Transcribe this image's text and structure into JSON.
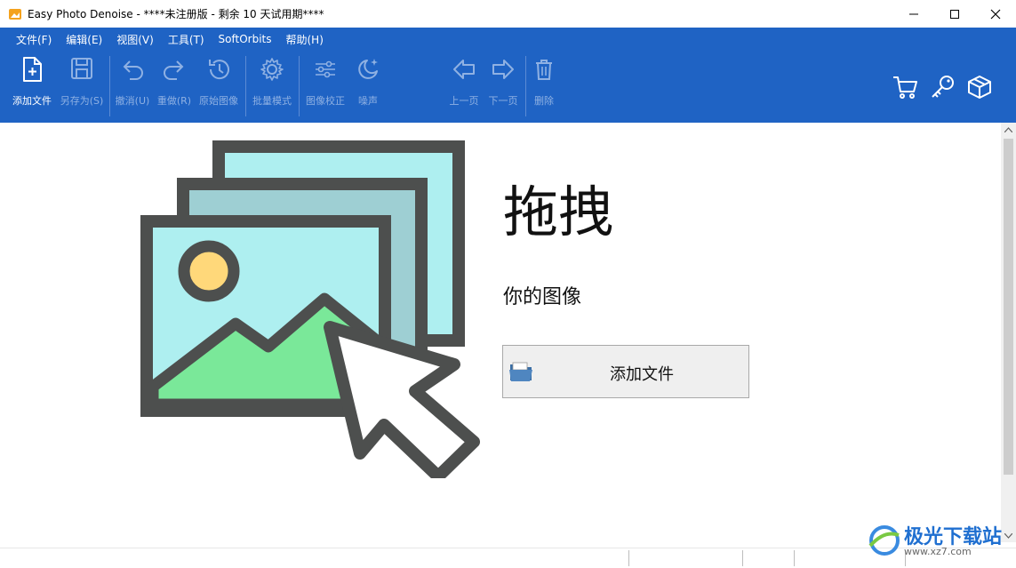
{
  "window": {
    "title": "Easy Photo Denoise - ****未注册版 - 剩余 10 天试用期****"
  },
  "menu": [
    {
      "label": "文件(F)"
    },
    {
      "label": "编辑(E)"
    },
    {
      "label": "视图(V)"
    },
    {
      "label": "工具(T)"
    },
    {
      "label": "SoftOrbits"
    },
    {
      "label": "帮助(H)"
    }
  ],
  "toolbar": {
    "add_file": "添加文件",
    "save_as": "另存为(S)",
    "undo": "撤消(U)",
    "redo": "重做(R)",
    "original": "原始图像",
    "batch": "批量模式",
    "correct": "图像校正",
    "noise": "噪声",
    "prev": "上一页",
    "next": "下一页",
    "delete": "删除"
  },
  "main": {
    "drag_title": "拖拽",
    "drag_sub": "你的图像",
    "add_button": "添加文件"
  },
  "watermark": {
    "text": "极光下载站",
    "sub": "www.xz7.com"
  },
  "colors": {
    "toolbar_bg": "#1f63c4",
    "disabled_text": "#8fb1e3"
  }
}
